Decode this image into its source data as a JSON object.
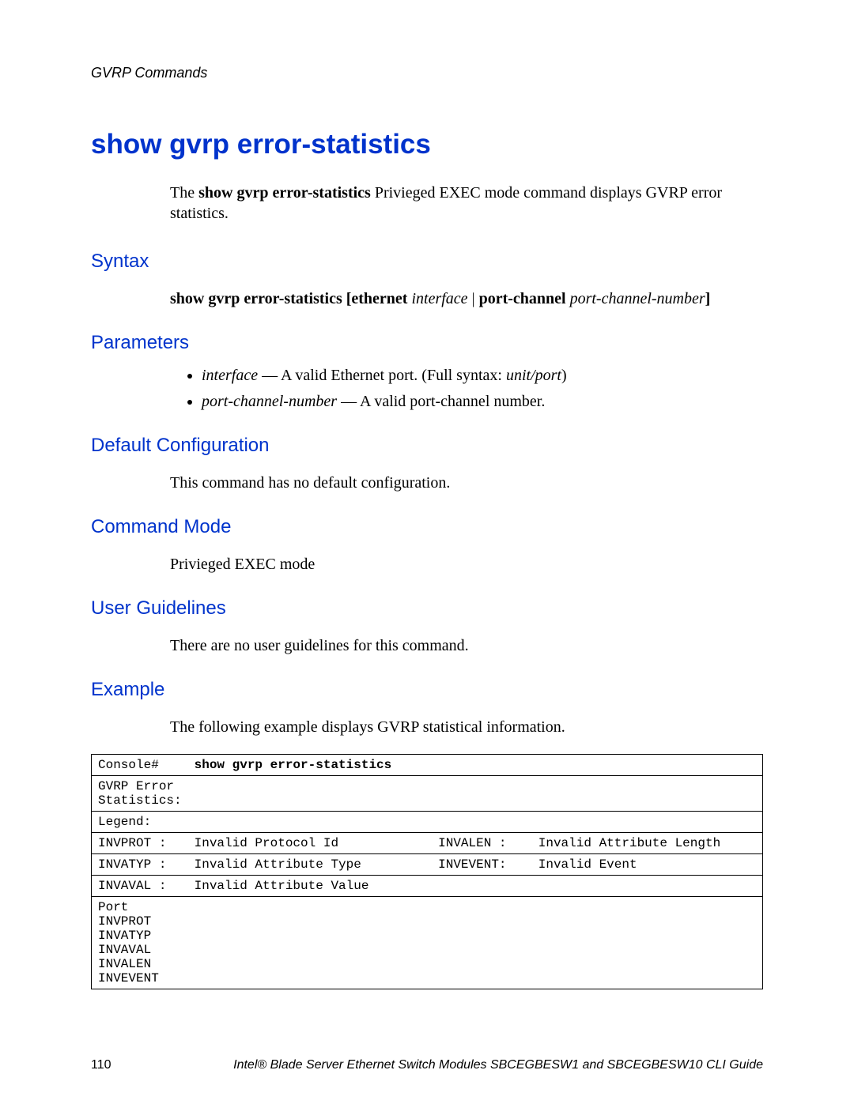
{
  "running_head": "GVRP Commands",
  "title": "show gvrp error-statistics",
  "intro": {
    "pre": "The ",
    "cmd": "show gvrp error-statistics",
    "post": " Privieged EXEC mode command displays GVRP error statistics."
  },
  "sections": {
    "syntax": "Syntax",
    "parameters": "Parameters",
    "default_cfg": "Default Configuration",
    "cmd_mode": "Command Mode",
    "user_guidelines": "User Guidelines",
    "example": "Example"
  },
  "syntax_line": {
    "p1": "show gvrp error-statistics [ethernet ",
    "i1": "interface",
    "p2": " | ",
    "p3": "port-channel ",
    "i2": "port-channel-number",
    "p4": "]"
  },
  "parameters": [
    {
      "term": "interface",
      "desc_pre": " — A valid Ethernet port. (Full syntax: ",
      "desc_it": "unit/port",
      "desc_post": ")"
    },
    {
      "term": "port-channel-number",
      "desc_pre": " — A valid port-channel number.",
      "desc_it": "",
      "desc_post": ""
    }
  ],
  "default_cfg_text": "This command has no default configuration.",
  "cmd_mode_text": "Privieged EXEC mode",
  "user_guidelines_text": "There are no user guidelines for this command.",
  "example_intro": "The following example displays GVRP statistical information.",
  "example_rows": [
    {
      "cells": [
        "Console# ",
        "show gvrp error-statistics",
        "",
        ""
      ],
      "bold_idx": 1
    },
    {
      "cells": [
        "GVRP Error Statistics:",
        "",
        "",
        ""
      ]
    },
    {
      "cells": [
        "Legend:",
        "",
        "",
        ""
      ]
    },
    {
      "cells": [
        "INVPROT :",
        "Invalid Protocol Id",
        "INVALEN :",
        "Invalid Attribute Length"
      ]
    },
    {
      "cells": [
        "INVATYP :",
        "Invalid Attribute Type",
        "INVEVENT:",
        "Invalid Event"
      ]
    },
    {
      "cells": [
        "INVAVAL :",
        "Invalid Attribute Value",
        "",
        ""
      ]
    },
    {
      "cells": [
        " Port INVPROT INVATYP INVAVAL INVALEN INVEVENT",
        "",
        "",
        ""
      ]
    }
  ],
  "footer": {
    "page": "110",
    "text": "Intel® Blade Server Ethernet Switch Modules SBCEGBESW1 and SBCEGBESW10 CLI Guide"
  }
}
